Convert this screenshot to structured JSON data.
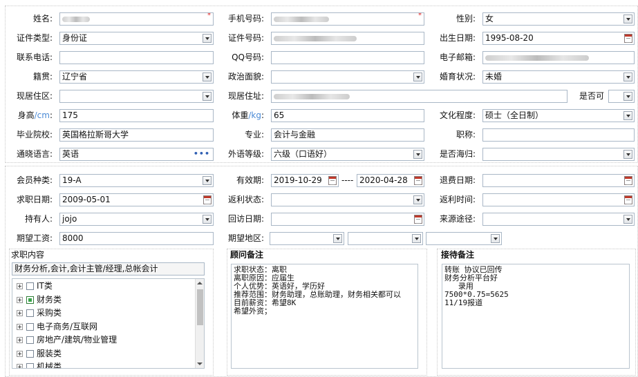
{
  "labels": {
    "name": "姓名:",
    "mobile": "手机号码:",
    "gender": "性别:",
    "id_type": "证件类型:",
    "id_number": "证件号码:",
    "birth_date": "出生日期:",
    "phone": "联系电话:",
    "qq": "QQ号码:",
    "email": "电子邮箱:",
    "hometown": "籍贯:",
    "politics": "政治面貌:",
    "marital": "婚育状况:",
    "residence_area": "现居住区:",
    "residence_address": "现居住址:",
    "is_ok": "是否可",
    "height": "身高",
    "height_unit": "/cm",
    "height_colon": ":",
    "weight": "体重",
    "weight_unit": "/kg",
    "weight_colon": ":",
    "education": "文化程度:",
    "school": "毕业院校:",
    "major": "专业:",
    "title": "职称:",
    "language": "通晓语言:",
    "language_level": "外语等级:",
    "overseas": "是否海归:",
    "member_type": "会员种类:",
    "validity": "有效期:",
    "refund_date": "退费日期:",
    "job_date": "求职日期:",
    "rebate_status": "返利状态:",
    "rebate_time": "返利时间:",
    "holder": "持有人:",
    "visit_date": "回访日期:",
    "source": "来源途径:",
    "salary": "期望工资:",
    "expected_area": "期望地区:"
  },
  "values": {
    "gender": "女",
    "id_type": "身份证",
    "birth_date": "1995-08-20",
    "hometown": "辽宁省",
    "marital": "未婚",
    "height": "175",
    "weight": "65",
    "education": "硕士（全日制）",
    "school": "英国格拉斯哥大学",
    "major": "会计与金融",
    "language": "英语",
    "language_level": "六级（口语好）",
    "member_type": "19-A",
    "validity_start": "2019-10-29",
    "validity_sep": "----",
    "validity_end": "2020-04-28",
    "job_date": "2009-05-01",
    "holder": "jojo",
    "salary": "8000"
  },
  "job_content": {
    "header": "求职内容",
    "selected": "财务分析,会计,会计主管/经理,总帐会计",
    "tree": [
      {
        "label": "IT类",
        "checked": false
      },
      {
        "label": "财务类",
        "checked": true
      },
      {
        "label": "采购类",
        "checked": false
      },
      {
        "label": "电子商务/互联网",
        "checked": false
      },
      {
        "label": "房地产/建筑/物业管理",
        "checked": false
      },
      {
        "label": "服装类",
        "checked": false
      },
      {
        "label": "机械类",
        "checked": false
      }
    ]
  },
  "consultant_notes": {
    "header": "顾问备注",
    "text": "求职状态：离职\n离职原因：应届生\n个人优势：英语好，学历好\n推荐范围：财务助理，总账助理，财务相关都可以\n目前薪资：希望8K\n希望外资；"
  },
  "receiver_notes": {
    "header": "接待备注",
    "text": "转账 协议已回传\n财务分析平台好\n   录用\n7500*0.75=5625\n11/19报道"
  },
  "required_mark": "*",
  "icons": {
    "dropdown": "chevron-down-icon",
    "calendar": "calendar-icon",
    "more": "ellipsis-icon",
    "expand": "plus-expander-icon"
  }
}
